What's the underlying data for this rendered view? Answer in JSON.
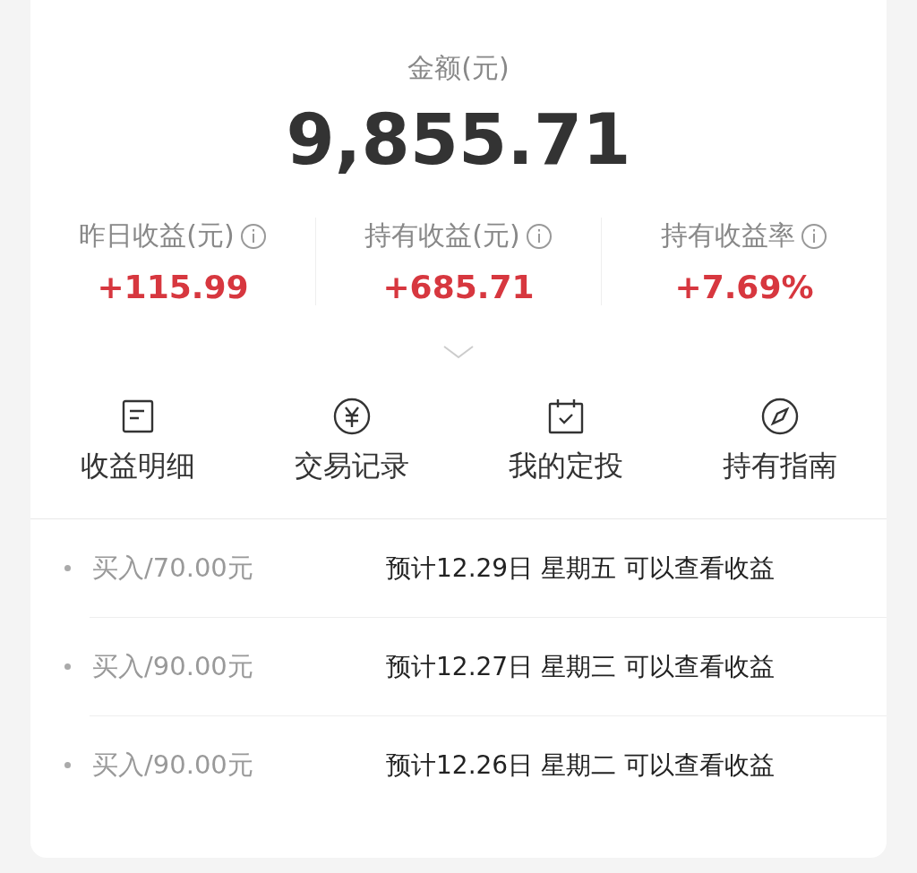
{
  "balance": {
    "label": "金额(元)",
    "amount": "9,855.71"
  },
  "stats": [
    {
      "label": "昨日收益(元)",
      "value": "+115.99"
    },
    {
      "label": "持有收益(元)",
      "value": "+685.71"
    },
    {
      "label": "持有收益率",
      "value": "+7.69%"
    }
  ],
  "shortcuts": [
    {
      "label": "收益明细"
    },
    {
      "label": "交易记录"
    },
    {
      "label": "我的定投"
    },
    {
      "label": "持有指南"
    }
  ],
  "pending": [
    {
      "order": "买入/70.00元",
      "note": "预计12.29日 星期五 可以查看收益"
    },
    {
      "order": "买入/90.00元",
      "note": "预计12.27日 星期三 可以查看收益"
    },
    {
      "order": "买入/90.00元",
      "note": "预计12.26日 星期二 可以查看收益"
    }
  ]
}
